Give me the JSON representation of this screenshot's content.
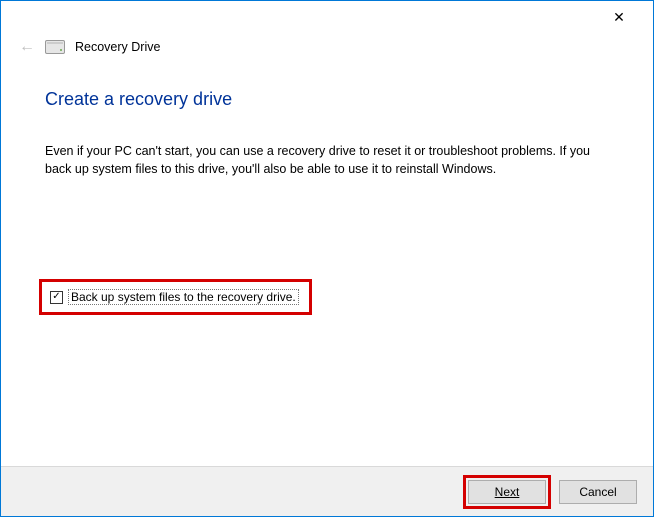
{
  "header": {
    "title": "Recovery Drive"
  },
  "main": {
    "title": "Create a recovery drive",
    "description": "Even if your PC can't start, you can use a recovery drive to reset it or troubleshoot problems. If you back up system files to this drive, you'll also be able to use it to reinstall Windows."
  },
  "checkbox": {
    "checked": true,
    "label": "Back up system files to the recovery drive."
  },
  "footer": {
    "next_label": "Next",
    "cancel_label": "Cancel"
  },
  "icons": {
    "close": "✕",
    "back": "←",
    "check": "✓"
  }
}
